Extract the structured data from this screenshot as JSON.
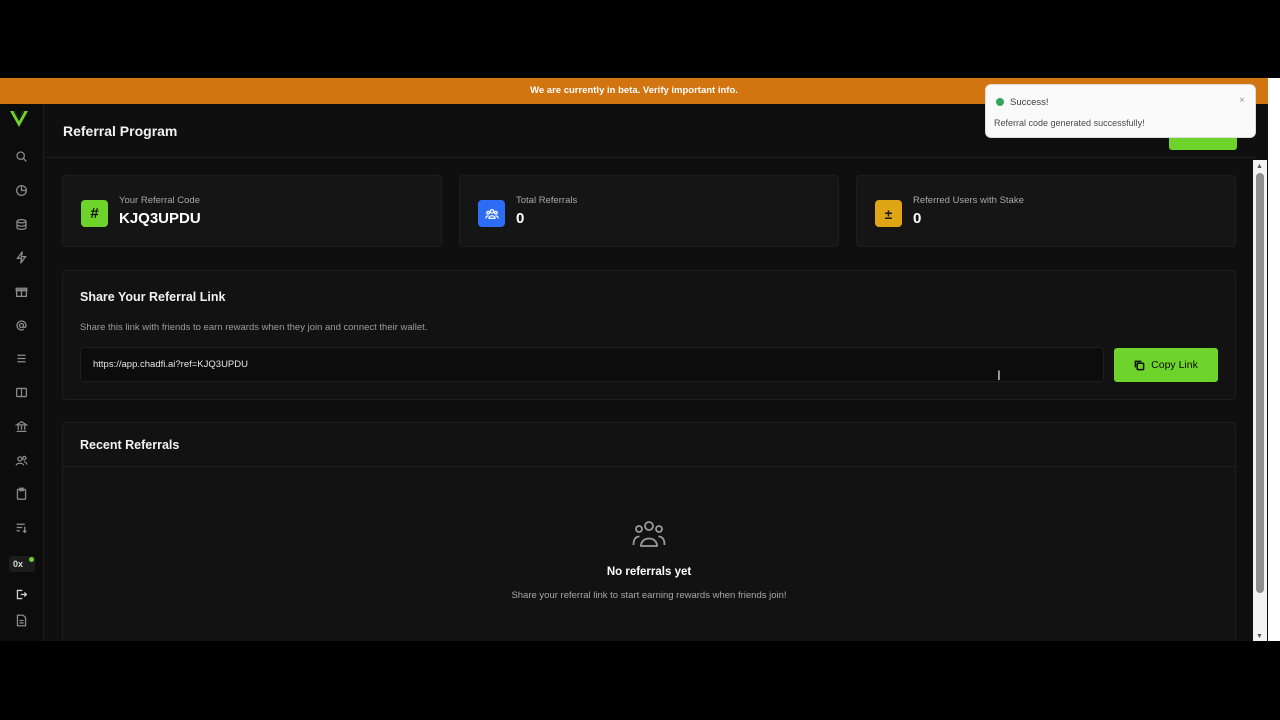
{
  "banner": {
    "text": "We are currently in beta. Verify important info."
  },
  "sidebar": {
    "icons": [
      "search-icon",
      "chart-pie-icon",
      "database-icon",
      "lightning-icon",
      "gift-icon",
      "at-sign-icon",
      "list-icon",
      "book-icon",
      "bank-icon",
      "users-icon",
      "clipboard-icon",
      "sort-icon",
      "logout-icon",
      "document-icon"
    ],
    "wallet_label": "0x"
  },
  "header": {
    "title": "Referral Program"
  },
  "stats": [
    {
      "icon": "hash-icon",
      "label": "Your Referral Code",
      "value": "KJQ3UPDU",
      "color": "#6ed32a"
    },
    {
      "icon": "users-icon",
      "label": "Total Referrals",
      "value": "0",
      "color": "#2d6cf5"
    },
    {
      "icon": "plus-minus-icon",
      "label": "Referred Users with Stake",
      "value": "0",
      "color": "#e0a514"
    }
  ],
  "share": {
    "title": "Share Your Referral Link",
    "description": "Share this link with friends to earn rewards when they join and connect their wallet.",
    "link": "https://app.chadfi.ai?ref=KJQ3UPDU",
    "copy_label": "Copy Link"
  },
  "recent": {
    "title": "Recent Referrals",
    "empty_title": "No referrals yet",
    "empty_desc": "Share your referral link to start earning rewards when friends join!"
  },
  "toast": {
    "title": "Success!",
    "message": "Referral code generated successfully!",
    "close": "×"
  },
  "colors": {
    "accent": "#6ed32a",
    "banner": "#d27410",
    "background": "#0f0f0f"
  }
}
